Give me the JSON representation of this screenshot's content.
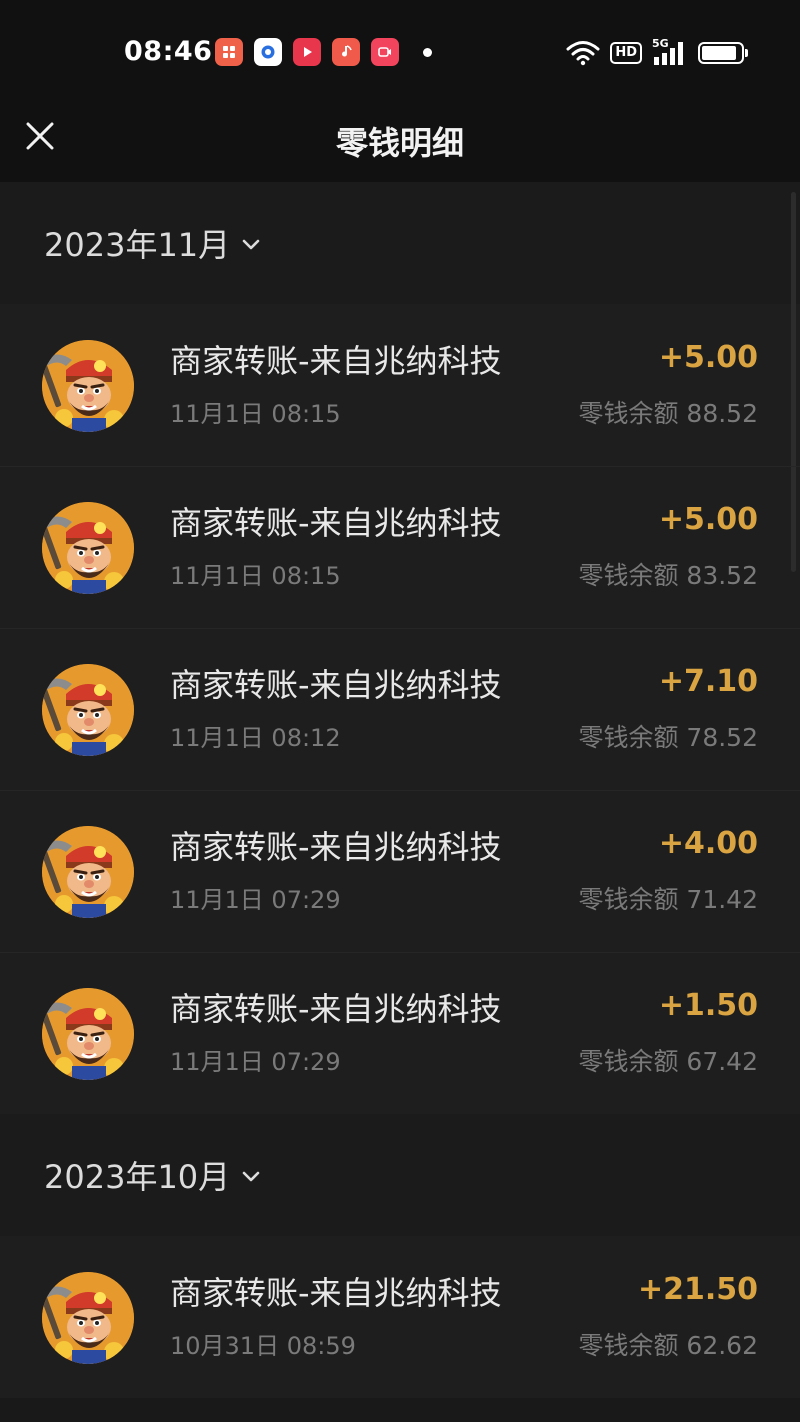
{
  "status_bar": {
    "time": "08:46",
    "app_icons": [
      {
        "name": "video-app-icon",
        "color": "#f0614a"
      },
      {
        "name": "blue-app-icon",
        "color": "#2a6fe0"
      },
      {
        "name": "red-play-app-icon",
        "color": "#e8364d"
      },
      {
        "name": "music-app-icon",
        "color": "#f05a4a"
      },
      {
        "name": "camera-app-icon",
        "color": "#f2445c"
      }
    ],
    "hd_label": "HD",
    "network": "5G",
    "battery_level": 0.9
  },
  "nav": {
    "title": "零钱明细"
  },
  "sections": [
    {
      "month": "2023年11月",
      "transactions": [
        {
          "title": "商家转账-来自兆纳科技",
          "date": "11月1日 08:15",
          "amount": "+5.00",
          "balance": "零钱余额 88.52"
        },
        {
          "title": "商家转账-来自兆纳科技",
          "date": "11月1日 08:15",
          "amount": "+5.00",
          "balance": "零钱余额 83.52"
        },
        {
          "title": "商家转账-来自兆纳科技",
          "date": "11月1日 08:12",
          "amount": "+7.10",
          "balance": "零钱余额 78.52"
        },
        {
          "title": "商家转账-来自兆纳科技",
          "date": "11月1日 07:29",
          "amount": "+4.00",
          "balance": "零钱余额 71.42"
        },
        {
          "title": "商家转账-来自兆纳科技",
          "date": "11月1日 07:29",
          "amount": "+1.50",
          "balance": "零钱余额 67.42"
        }
      ]
    },
    {
      "month": "2023年10月",
      "transactions": [
        {
          "title": "商家转账-来自兆纳科技",
          "date": "10月31日 08:59",
          "amount": "+21.50",
          "balance": "零钱余额 62.62"
        }
      ]
    }
  ],
  "colors": {
    "amount": "#d9a441",
    "background": "#191919"
  }
}
